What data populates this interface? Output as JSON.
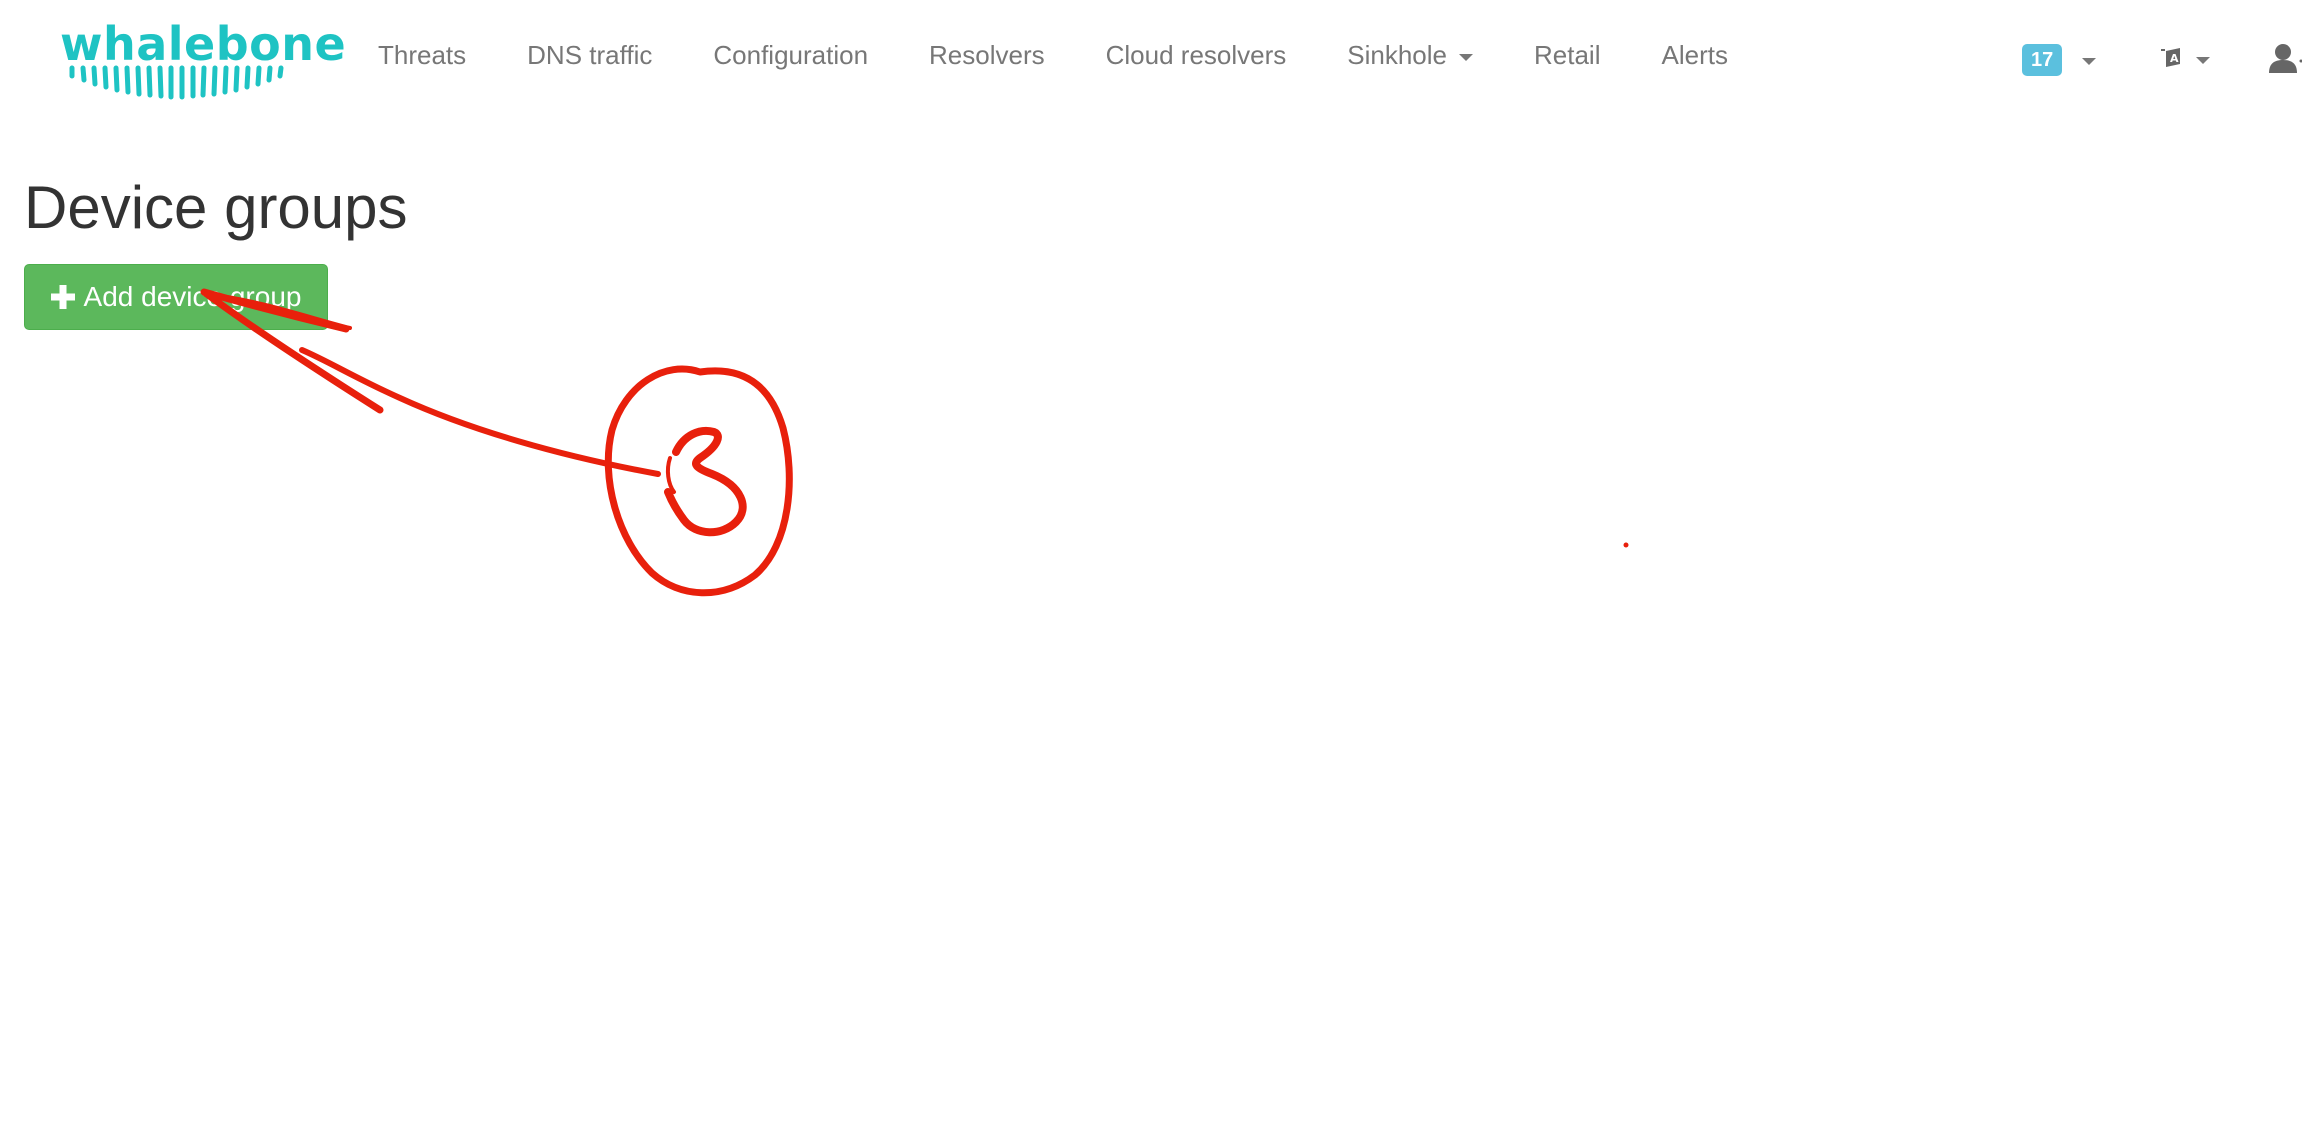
{
  "brand": {
    "logo_text": "whalebone",
    "logo_color": "#1ec3c3"
  },
  "nav": {
    "items": [
      {
        "label": "Threats"
      },
      {
        "label": "DNS traffic"
      },
      {
        "label": "Configuration"
      },
      {
        "label": "Resolvers"
      },
      {
        "label": "Cloud resolvers"
      },
      {
        "label": "Sinkhole",
        "dropdown": true
      },
      {
        "label": "Retail"
      },
      {
        "label": "Alerts"
      }
    ],
    "notifications": {
      "count": "17",
      "icon": "chevron-down-icon",
      "color": "#5bc0de"
    },
    "language": {
      "icon": "language-icon"
    },
    "user": {
      "icon": "user-icon"
    }
  },
  "main": {
    "title": "Device groups",
    "add_button": {
      "label": "Add device group",
      "icon": "plus-icon",
      "color": "#5cb85c"
    }
  },
  "annotation": {
    "step_number": "3",
    "color": "#e8200c",
    "shape": "circled-number-with-arrow"
  }
}
